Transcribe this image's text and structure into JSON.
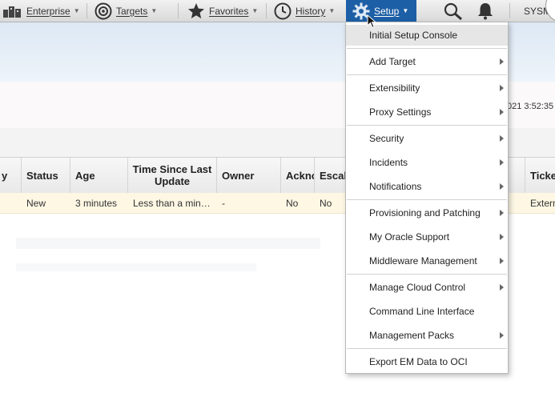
{
  "nav": {
    "enterprise": "Enterprise",
    "targets": "Targets",
    "favorites": "Favorites",
    "history": "History",
    "setup": "Setup",
    "user": "SYSM",
    "accent_color": "#1d5fa6"
  },
  "page": {
    "timestamp": "021 3:52:35"
  },
  "table": {
    "headers": {
      "severity": "y",
      "status": "Status",
      "age": "Age",
      "time_since_update": "Time Since Last Update",
      "owner": "Owner",
      "acknowledged": "Ackno",
      "escalated": "Escal",
      "ticket": "Ticke"
    },
    "row": {
      "status": "New",
      "age": "3 minutes",
      "time_since_update": "Less than a min…",
      "owner": "-",
      "acknowledged": "No",
      "escalated": "No",
      "ticket": "Extern"
    },
    "row_color": "#fdf7e4"
  },
  "setup_menu": {
    "items": [
      {
        "label": "Initial Setup Console",
        "submenu": false
      },
      {
        "label": "Add Target",
        "submenu": true
      },
      {
        "label": "Extensibility",
        "submenu": true
      },
      {
        "label": "Proxy Settings",
        "submenu": true
      },
      {
        "label": "Security",
        "submenu": true
      },
      {
        "label": "Incidents",
        "submenu": true
      },
      {
        "label": "Notifications",
        "submenu": true
      },
      {
        "label": "Provisioning and Patching",
        "submenu": true
      },
      {
        "label": "My Oracle Support",
        "submenu": true
      },
      {
        "label": "Middleware Management",
        "submenu": true
      },
      {
        "label": "Manage Cloud Control",
        "submenu": true
      },
      {
        "label": "Command Line Interface",
        "submenu": false
      },
      {
        "label": "Management Packs",
        "submenu": true
      },
      {
        "label": "Export EM Data to OCI",
        "submenu": false
      }
    ]
  }
}
